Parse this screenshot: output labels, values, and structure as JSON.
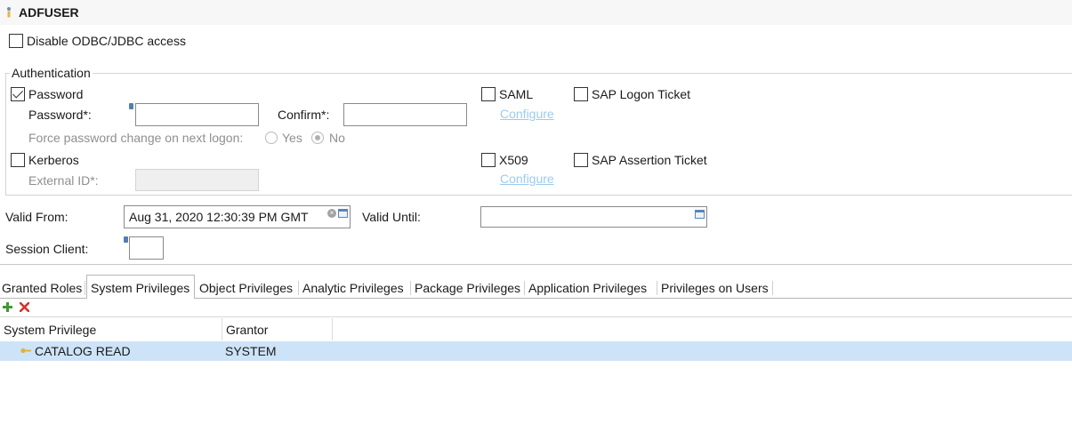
{
  "header": {
    "title": "ADFUSER",
    "user_icon": "user-icon"
  },
  "disable_odbc": {
    "label": "Disable ODBC/JDBC access",
    "checked": false
  },
  "authentication": {
    "group_label": "Authentication",
    "password": {
      "label": "Password",
      "checked": true,
      "password_label": "Password*:",
      "password_value": "",
      "confirm_label": "Confirm*:",
      "confirm_value": "",
      "force_change_label": "Force password change on next logon:",
      "options": [
        "Yes",
        "No"
      ],
      "selected": "No"
    },
    "kerberos": {
      "label": "Kerberos",
      "checked": false,
      "external_id_label": "External ID*:",
      "external_id_value": ""
    },
    "saml": {
      "label": "SAML",
      "checked": false,
      "configure": "Configure"
    },
    "sap_logon_ticket": {
      "label": "SAP Logon Ticket",
      "checked": false
    },
    "x509": {
      "label": "X509",
      "checked": false,
      "configure": "Configure"
    },
    "sap_assertion_ticket": {
      "label": "SAP Assertion Ticket",
      "checked": false
    }
  },
  "validity": {
    "valid_from_label": "Valid From:",
    "valid_from_value": "Aug 31, 2020 12:30:39 PM GMT",
    "valid_until_label": "Valid Until:",
    "valid_until_value": ""
  },
  "session_client": {
    "label": "Session Client:",
    "value": ""
  },
  "tabs": [
    {
      "label": "Granted Roles",
      "active": false
    },
    {
      "label": "System Privileges",
      "active": true
    },
    {
      "label": "Object Privileges",
      "active": false
    },
    {
      "label": "Analytic Privileges",
      "active": false
    },
    {
      "label": "Package Privileges",
      "active": false
    },
    {
      "label": "Application Privileges",
      "active": false
    },
    {
      "label": "Privileges on Users",
      "active": false
    }
  ],
  "toolbar": {
    "add_icon": "plus-icon",
    "remove_icon": "delete-x-icon"
  },
  "table": {
    "columns": [
      "System Privilege",
      "Grantor"
    ],
    "rows": [
      {
        "privilege": "CATALOG READ",
        "grantor": "SYSTEM",
        "selected": true
      }
    ]
  },
  "colors": {
    "selection": "#cde3f7",
    "link": "#9ccbef",
    "add": "#3f9a36",
    "remove": "#d6322b"
  }
}
